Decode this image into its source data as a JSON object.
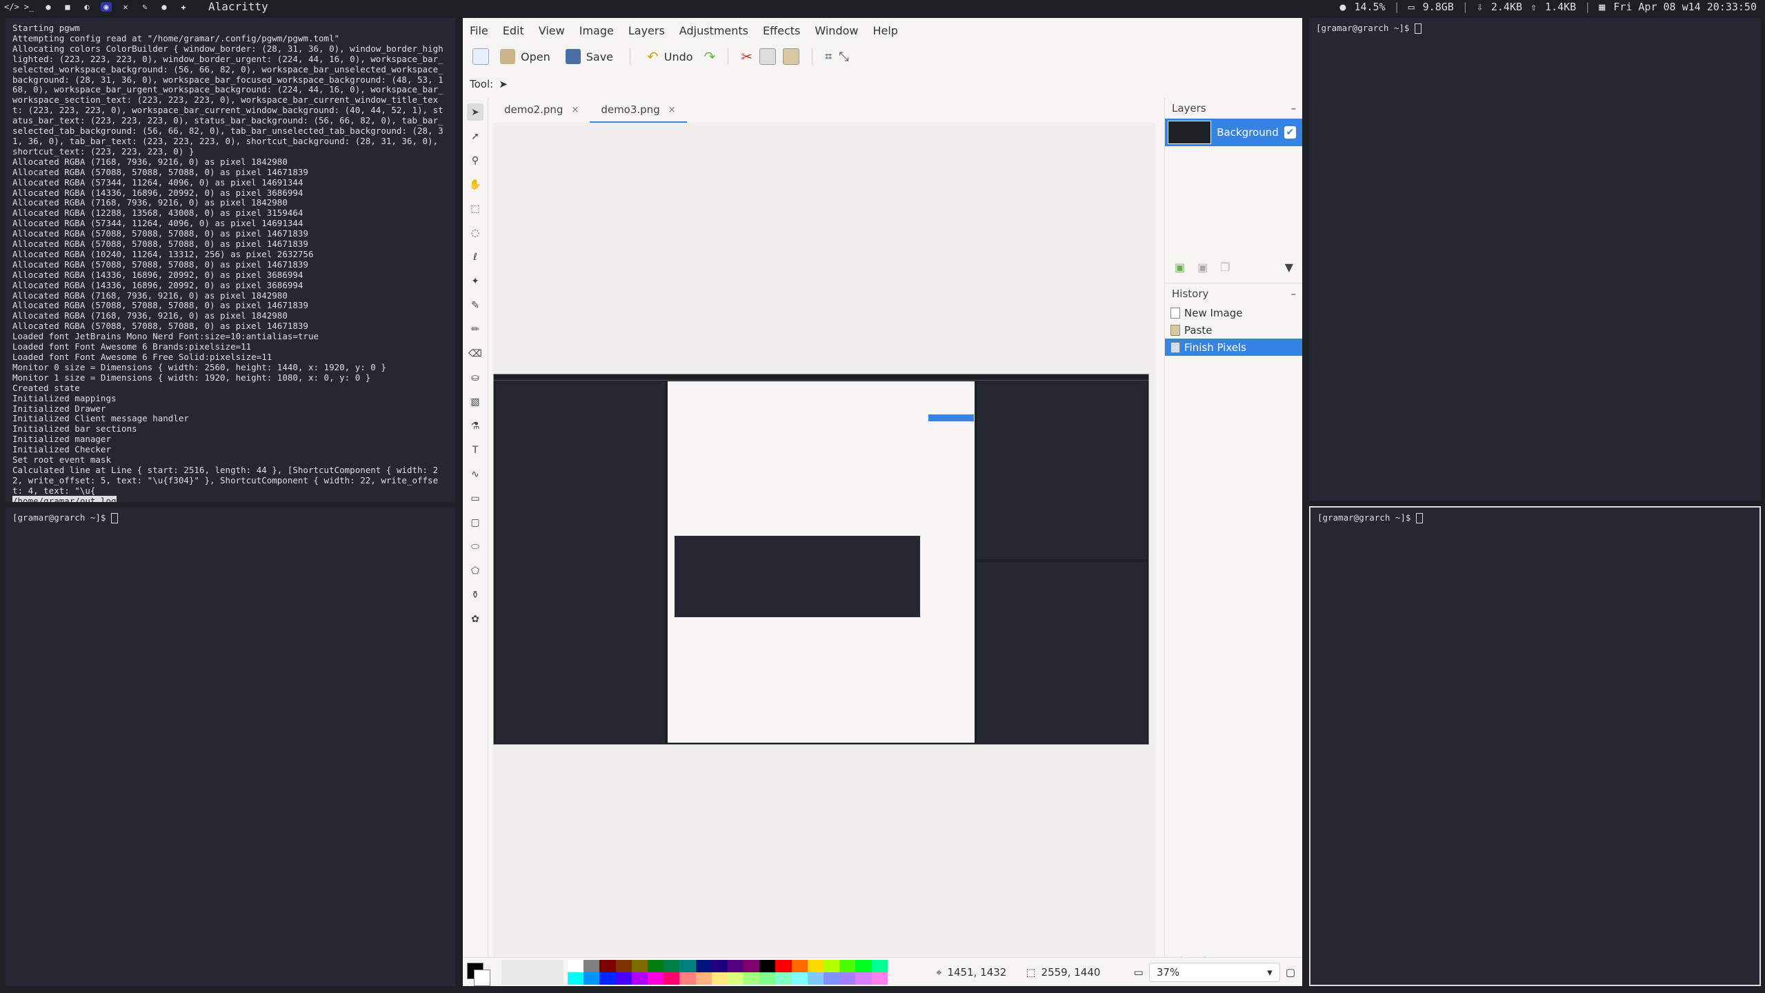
{
  "topbar": {
    "workspaces": [
      "</>",
      ">_",
      "●",
      "■",
      "◐",
      "◉",
      "✕",
      "✎",
      "●",
      "✚"
    ],
    "focused_workspace_index": 5,
    "window_title": "Alacritty",
    "cpu": "14.5%",
    "mem": "9.8GB",
    "net_down": "2.4KB",
    "net_up": "1.4KB",
    "datetime": "Fri Apr 08 w14 20:33:50"
  },
  "terminals": {
    "left_top_lines": [
      "Starting pgwm",
      "Attempting config read at \"/home/gramar/.config/pgwm/pgwm.toml\"",
      "Allocating colors ColorBuilder { window_border: (28, 31, 36, 0), window_border_highlighted: (223, 223, 223, 0), window_border_urgent: (224, 44, 16, 0), workspace_bar_selected_workspace_background: (56, 66, 82, 0), workspace_bar_unselected_workspace_background: (28, 31, 36, 0), workspace_bar_focused_workspace_background: (48, 53, 168, 0), workspace_bar_urgent_workspace_background: (224, 44, 16, 0), workspace_bar_workspace_section_text: (223, 223, 223, 0), workspace_bar_current_window_title_text: (223, 223, 223, 0), workspace_bar_current_window_background: (40, 44, 52, 1), status_bar_text: (223, 223, 223, 0), status_bar_background: (56, 66, 82, 0), tab_bar_selected_tab_background: (56, 66, 82, 0), tab_bar_unselected_tab_background: (28, 31, 36, 0), tab_bar_text: (223, 223, 223, 0), shortcut_background: (28, 31, 36, 0), shortcut_text: (223, 223, 223, 0) }",
      "Allocated RGBA (7168, 7936, 9216, 0) as pixel 1842980",
      "Allocated RGBA (57088, 57088, 57088, 0) as pixel 14671839",
      "Allocated RGBA (57344, 11264, 4096, 0) as pixel 14691344",
      "Allocated RGBA (14336, 16896, 20992, 0) as pixel 3686994",
      "Allocated RGBA (7168, 7936, 9216, 0) as pixel 1842980",
      "Allocated RGBA (12288, 13568, 43008, 0) as pixel 3159464",
      "Allocated RGBA (57344, 11264, 4096, 0) as pixel 14691344",
      "Allocated RGBA (57088, 57088, 57088, 0) as pixel 14671839",
      "Allocated RGBA (57088, 57088, 57088, 0) as pixel 14671839",
      "Allocated RGBA (10240, 11264, 13312, 256) as pixel 2632756",
      "Allocated RGBA (57088, 57088, 57088, 0) as pixel 14671839",
      "Allocated RGBA (14336, 16896, 20992, 0) as pixel 3686994",
      "Allocated RGBA (14336, 16896, 20992, 0) as pixel 3686994",
      "Allocated RGBA (7168, 7936, 9216, 0) as pixel 1842980",
      "Allocated RGBA (57088, 57088, 57088, 0) as pixel 14671839",
      "Allocated RGBA (7168, 7936, 9216, 0) as pixel 1842980",
      "Allocated RGBA (57088, 57088, 57088, 0) as pixel 14671839",
      "Loaded font JetBrains Mono Nerd Font:size=10:antialias=true",
      "Loaded font Font Awesome 6 Brands:pixelsize=11",
      "Loaded font Font Awesome 6 Free Solid:pixelsize=11",
      "Monitor 0 size = Dimensions { width: 2560, height: 1440, x: 1920, y: 0 }",
      "Monitor 1 size = Dimensions { width: 1920, height: 1080, x: 0, y: 0 }",
      "Created state",
      "Initialized mappings",
      "Initialized Drawer",
      "Initialized Client message handler",
      "Initialized bar sections",
      "Initialized manager",
      "Initialized Checker",
      "Set root event mask",
      "Calculated line at Line { start: 2516, length: 44 }, [ShortcutComponent { width: 22, write_offset: 5, text: \"\\u{f304}\" }, ShortcutComponent { width: 22, write_offset: 4, text: \"\\u{"
    ],
    "left_top_highlight": "/home/gramar/out.log",
    "prompt": "[gramar@grarch ~]$ "
  },
  "pinta": {
    "menu": [
      "File",
      "Edit",
      "View",
      "Image",
      "Layers",
      "Adjustments",
      "Effects",
      "Window",
      "Help"
    ],
    "toolbar": {
      "open": "Open",
      "save": "Save",
      "undo": "Undo"
    },
    "tool_label": "Tool:",
    "tabs": [
      {
        "label": "demo2.png",
        "close": "×"
      },
      {
        "label": "demo3.png",
        "close": "×"
      }
    ],
    "active_tab_index": 1,
    "layers_title": "Layers",
    "layers": [
      {
        "name": "Background",
        "checked": "✔"
      }
    ],
    "history_title": "History",
    "history": [
      "New Image",
      "Paste",
      "Finish Pixels"
    ],
    "history_selected_index": 2,
    "cursor_pos": "1451, 1432",
    "selection_size": "2559, 1440",
    "zoom": "37%",
    "accent": "#3584e4"
  },
  "palette": [
    "#ffffff",
    "#808080",
    "#7f0000",
    "#7f3300",
    "#7f6a00",
    "#007f0e",
    "#007f46",
    "#007f7f",
    "#00137f",
    "#21007f",
    "#57007f",
    "#7f006e",
    "#000000",
    "#ff0000",
    "#ff6a00",
    "#ffd800",
    "#b6ff00",
    "#4cff00",
    "#00ff21",
    "#00ff90",
    "#00ffff",
    "#0094ff",
    "#0026ff",
    "#4800ff",
    "#b200ff",
    "#ff00dc",
    "#ff006e",
    "#ff7f7f",
    "#ffb27f",
    "#ffe97f",
    "#daff7f",
    "#a5ff7f",
    "#7fff8e",
    "#7fffc5",
    "#7fffff",
    "#7fc9ff",
    "#7f92ff",
    "#a17fff",
    "#d67fff",
    "#ff7fed"
  ]
}
